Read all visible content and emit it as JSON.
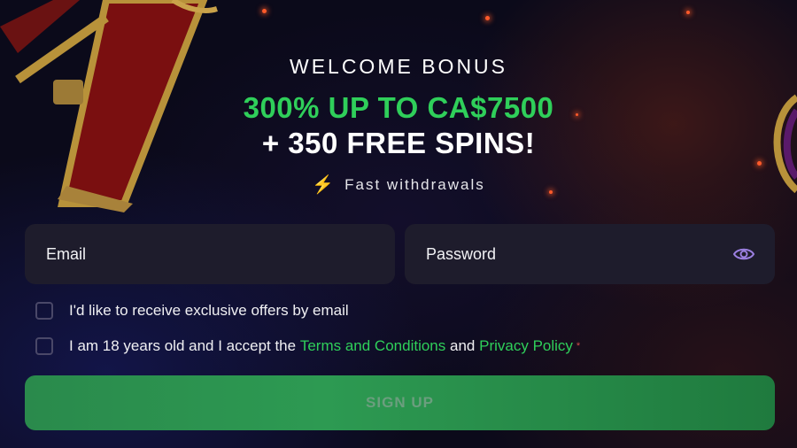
{
  "header": {
    "welcome": "WELCOME BONUS",
    "bonus": "300% UP TO CA$7500",
    "spins": "+ 350 FREE SPINS!",
    "feature_icon": "lightning-bolt-icon",
    "feature": "Fast withdrawals"
  },
  "form": {
    "email_placeholder": "Email",
    "password_placeholder": "Password",
    "password_toggle_icon": "eye-icon",
    "offers_label": "I'd like to receive exclusive offers by email",
    "terms_prefix": "I am 18 years old and I accept the",
    "terms_link": "Terms and Conditions",
    "terms_and": "and",
    "privacy_link": "Privacy Policy",
    "required_mark": "*",
    "signup_label": "SIGN UP"
  },
  "colors": {
    "accent_green": "#2fcf5a",
    "field_bg": "#1e1c2c",
    "button_green": "#2d9a52",
    "eye_purple": "#9b7fe0"
  }
}
